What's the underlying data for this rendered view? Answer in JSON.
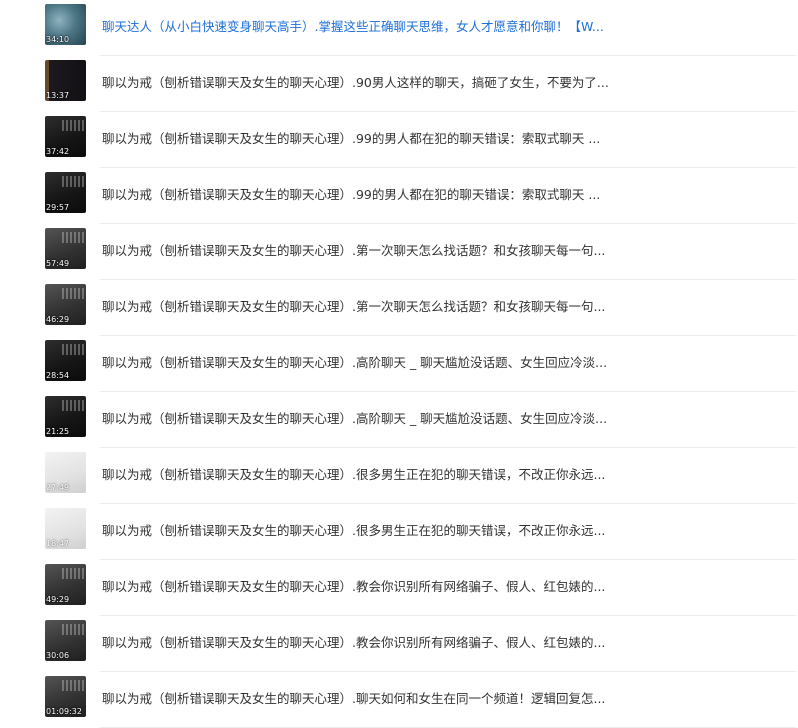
{
  "videos": [
    {
      "duration": "34:10",
      "thumb_style": "teal",
      "title": "聊天达人（从小白快速变身聊天高手）.掌握这些正确聊天思维，女人才愿意和你聊！【W..."
    },
    {
      "duration": "13:37",
      "thumb_style": "brown",
      "title": "聊以为戒（刨析错误聊天及女生的聊天心理）.90男人这样的聊天，搞砸了女生，不要为了..."
    },
    {
      "duration": "37:42",
      "thumb_style": "dark",
      "title": "聊以为戒（刨析错误聊天及女生的聊天心理）.99的男人都在犯的聊天错误：索取式聊天 ..."
    },
    {
      "duration": "29:57",
      "thumb_style": "dark",
      "title": "聊以为戒（刨析错误聊天及女生的聊天心理）.99的男人都在犯的聊天错误：索取式聊天 ..."
    },
    {
      "duration": "57:49",
      "thumb_style": "gray",
      "title": "聊以为戒（刨析错误聊天及女生的聊天心理）.第一次聊天怎么找话题？和女孩聊天每一句..."
    },
    {
      "duration": "46:29",
      "thumb_style": "gray",
      "title": "聊以为戒（刨析错误聊天及女生的聊天心理）.第一次聊天怎么找话题？和女孩聊天每一句..."
    },
    {
      "duration": "28:54",
      "thumb_style": "dark",
      "title": "聊以为戒（刨析错误聊天及女生的聊天心理）.高阶聊天 _ 聊天尴尬没话题、女生回应冷淡..."
    },
    {
      "duration": "21:25",
      "thumb_style": "dark",
      "title": "聊以为戒（刨析错误聊天及女生的聊天心理）.高阶聊天 _ 聊天尴尬没话题、女生回应冷淡..."
    },
    {
      "duration": "27:49",
      "thumb_style": "light",
      "title": "聊以为戒（刨析错误聊天及女生的聊天心理）.很多男生正在犯的聊天错误，不改正你永远..."
    },
    {
      "duration": "18:47",
      "thumb_style": "light",
      "title": "聊以为戒（刨析错误聊天及女生的聊天心理）.很多男生正在犯的聊天错误，不改正你永远..."
    },
    {
      "duration": "49:29",
      "thumb_style": "gray",
      "title": "聊以为戒（刨析错误聊天及女生的聊天心理）.教会你识别所有网络骗子、假人、红包婊的..."
    },
    {
      "duration": "30:06",
      "thumb_style": "gray",
      "title": "聊以为戒（刨析错误聊天及女生的聊天心理）.教会你识别所有网络骗子、假人、红包婊的..."
    },
    {
      "duration": "01:09:32",
      "thumb_style": "gray",
      "title": "聊以为戒（刨析错误聊天及女生的聊天心理）.聊天如何和女生在同一个频道！逻辑回复怎..."
    }
  ]
}
